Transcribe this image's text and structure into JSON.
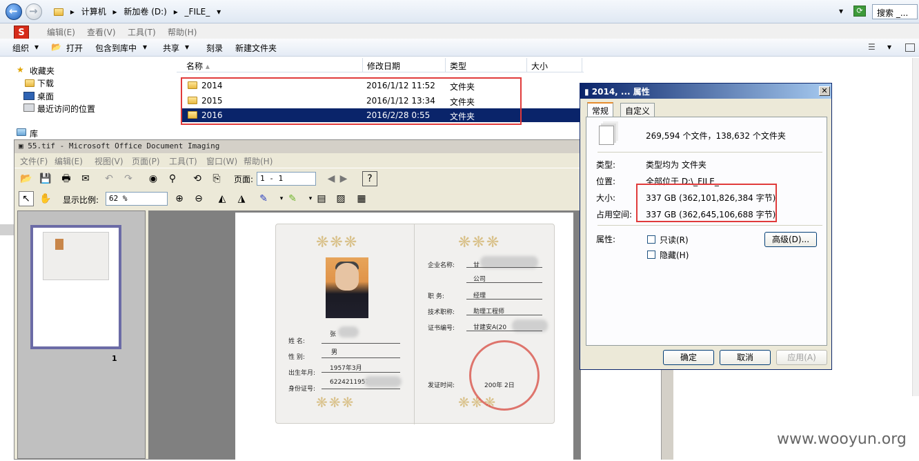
{
  "explorer": {
    "address": [
      "计算机",
      "新加卷 (D:)",
      "_FILE_"
    ],
    "search_placeholder": "搜索 _...",
    "menu": [
      "编辑(E)",
      "查看(V)",
      "工具(T)",
      "帮助(H)"
    ],
    "toolbar": [
      "组织",
      "打开",
      "包含到库中",
      "共享",
      "刻录",
      "新建文件夹"
    ],
    "nav": {
      "favorites": "收藏夹",
      "items": [
        "下载",
        "桌面",
        "最近访问的位置"
      ],
      "library": "库"
    },
    "columns": [
      "名称",
      "修改日期",
      "类型",
      "大小"
    ],
    "files": [
      {
        "name": "2014",
        "date": "2016/1/12 11:52",
        "type": "文件夹"
      },
      {
        "name": "2015",
        "date": "2016/1/12 13:34",
        "type": "文件夹"
      },
      {
        "name": "2016",
        "date": "2016/2/28 0:55",
        "type": "文件夹"
      }
    ]
  },
  "imaging": {
    "title": "55.tif - Microsoft Office Document Imaging",
    "menu": [
      "文件(F)",
      "编辑(E)",
      "视图(V)",
      "页面(P)",
      "工具(T)",
      "窗口(W)",
      "帮助(H)"
    ],
    "page_label": "页面:",
    "page_value": "1 - 1",
    "zoom_label": "显示比例:",
    "zoom_value": "62 %",
    "thumb_number": "1",
    "cert": {
      "company_label": "企业名称:",
      "company_value": "甘",
      "company_suffix": "公司",
      "position_label": "职    务:",
      "position_value": "经理",
      "title_label": "技术职称:",
      "title_value": "助理工程师",
      "cert_no_label": "证书编号:",
      "cert_no_value": "甘建安A(20",
      "issue_label": "发证时间:",
      "issue_value": "200年   2日",
      "name_label": "姓    名:",
      "name_value": "张",
      "gender_label": "性    别:",
      "gender_value": "男",
      "birth_label": "出生年月:",
      "birth_value": "1957年3月",
      "id_label": "身份证号:",
      "id_value": "62242119570"
    }
  },
  "properties": {
    "title": "2014, ... 属性",
    "tabs": [
      "常规",
      "自定义"
    ],
    "count": "269,594 个文件，138,632 个文件夹",
    "type_label": "类型:",
    "type_value": "类型均为 文件夹",
    "location_label": "位置:",
    "location_value": "全部位于 D:\\_FILE_",
    "size_label": "大小:",
    "size_value": "337 GB (362,101,826,384 字节)",
    "disk_label": "占用空间:",
    "disk_value": "337 GB (362,645,106,688 字节)",
    "attr_label": "属性:",
    "readonly": "只读(R)",
    "hidden": "隐藏(H)",
    "advanced": "高级(D)...",
    "ok": "确定",
    "cancel": "取消",
    "apply": "应用(A)"
  },
  "watermark": "www.wooyun.org"
}
